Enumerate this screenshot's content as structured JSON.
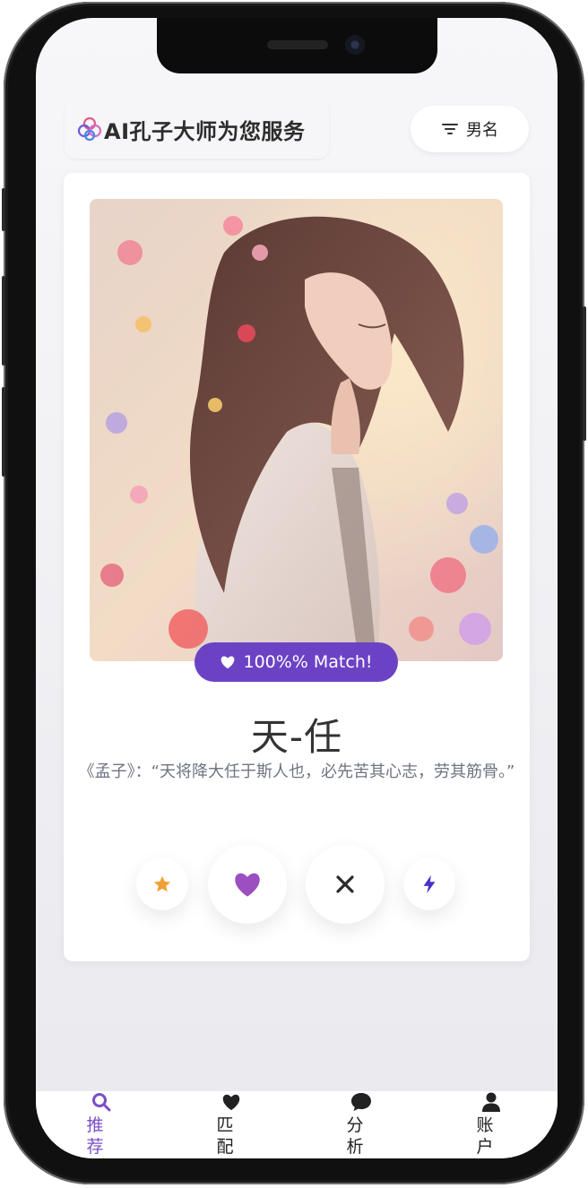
{
  "header": {
    "app_title": "AI孔子大师为您服务",
    "filter_label": "男名"
  },
  "card": {
    "match_label": "100%% Match!",
    "name": "天-任",
    "quote": "《孟子》：“天将降大任于斯人也，必先苦其心志，劳其筋骨。”",
    "actions": [
      {
        "icon": "star-icon",
        "color": "#f0a032"
      },
      {
        "icon": "heart-icon",
        "color": "#9b4fc0"
      },
      {
        "icon": "close-icon",
        "color": "#2a2a2a"
      },
      {
        "icon": "lightning-icon",
        "color": "#4a2fc8"
      }
    ]
  },
  "tab_bar": {
    "items": [
      {
        "label": "推荐",
        "icon": "search-icon",
        "active": true
      },
      {
        "label": "匹配",
        "icon": "heart-icon",
        "active": false
      },
      {
        "label": "分析",
        "icon": "chat-bubble-icon",
        "active": false
      },
      {
        "label": "账户",
        "icon": "user-icon",
        "active": false
      }
    ]
  },
  "colors": {
    "accent": "#6c42c5",
    "tab_active": "#7b4fc8",
    "tab_inactive": "#222222"
  }
}
